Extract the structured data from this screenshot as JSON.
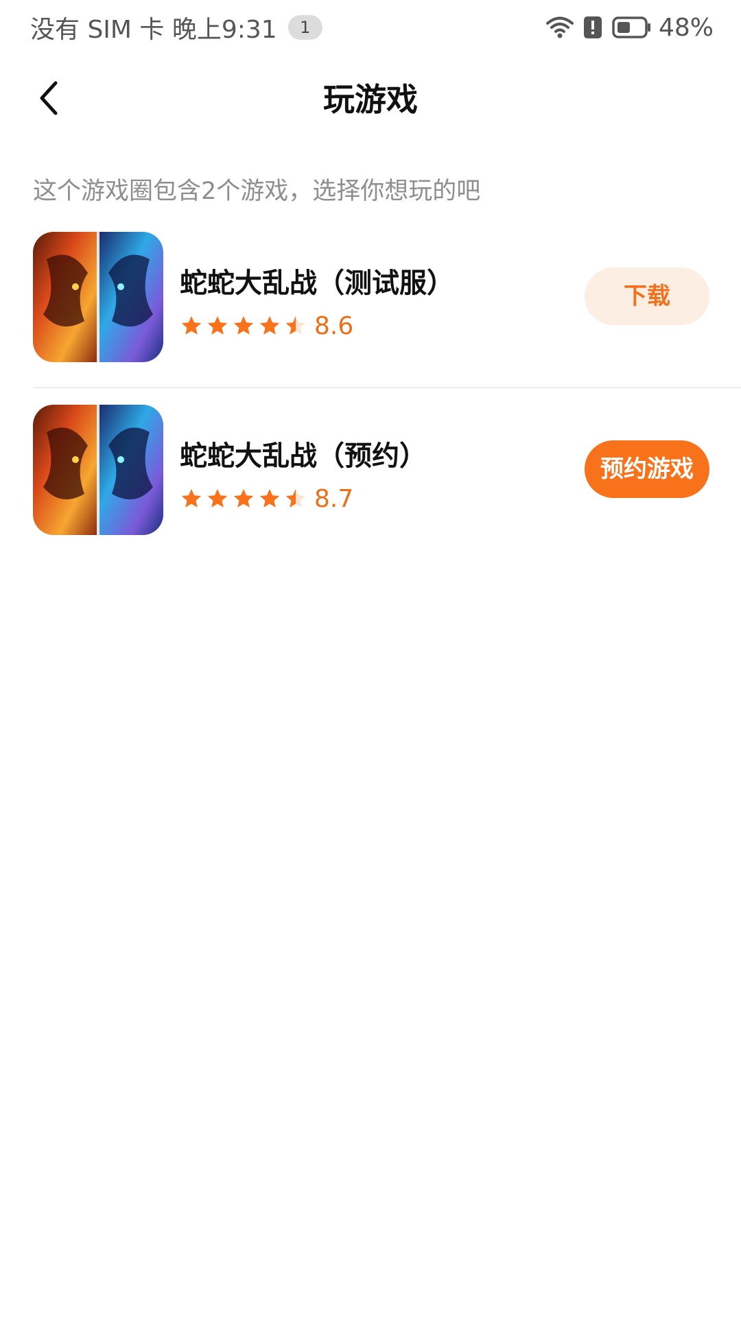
{
  "status_bar": {
    "left_text": "没有 SIM 卡 晚上9:31",
    "notification_count": "1",
    "battery_percent": "48%",
    "battery_level": 0.48,
    "icons": [
      "wifi-icon",
      "alert-icon",
      "battery-icon"
    ]
  },
  "header": {
    "title": "玩游戏",
    "back_icon": "chevron-left-icon"
  },
  "intro": "这个游戏圈包含2个游戏，选择你想玩的吧",
  "games": [
    {
      "name": "蛇蛇大乱战（测试服）",
      "rating": 8.6,
      "rating_text": "8.6",
      "stars_filled": 4.5,
      "button_label": "下载",
      "button_style": "light"
    },
    {
      "name": "蛇蛇大乱战（预约）",
      "rating": 8.7,
      "rating_text": "8.7",
      "stars_filled": 4.5,
      "button_label": "预约游戏",
      "button_style": "solid"
    }
  ],
  "colors": {
    "accent": "#f7721a",
    "accent_light_bg": "#fdeee4",
    "rating_text": "#ee6e14",
    "secondary_text": "#8e8e8e"
  }
}
